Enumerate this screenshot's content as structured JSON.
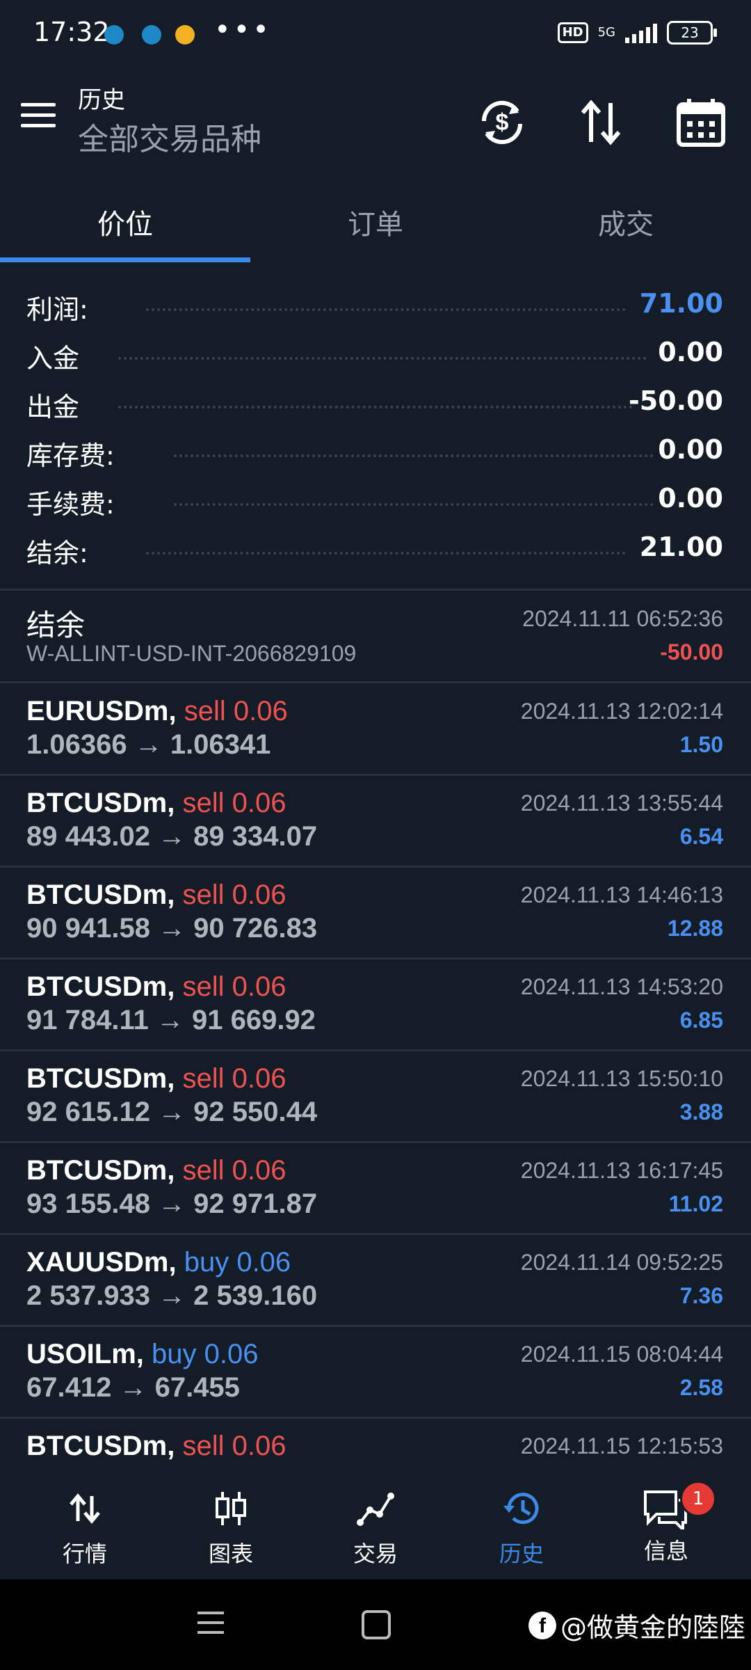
{
  "status_bar": {
    "time": "17:32",
    "network": "5G",
    "hd": "HD",
    "battery": "23",
    "more": "•••"
  },
  "app_bar": {
    "title": "历史",
    "subtitle": "全部交易品种"
  },
  "tabs": [
    {
      "label": "价位",
      "active": true
    },
    {
      "label": "订单",
      "active": false
    },
    {
      "label": "成交",
      "active": false
    }
  ],
  "summary": [
    {
      "label": "利润:",
      "value": "71.00"
    },
    {
      "label": "入金",
      "value": "0.00"
    },
    {
      "label": "出金",
      "value": "-50.00"
    },
    {
      "label": "库存费:",
      "value": "0.00"
    },
    {
      "label": "手续费:",
      "value": "0.00"
    },
    {
      "label": "结余:",
      "value": "21.00"
    }
  ],
  "balance_entry": {
    "title": "结余",
    "id": "W-ALLINT-USD-INT-2066829109",
    "time": "2024.11.11 06:52:36",
    "amount": "-50.00"
  },
  "deals": [
    {
      "symbol": "EURUSDm,",
      "side": "sell 0.06",
      "prices": "1.06366 → 1.06341",
      "time": "2024.11.13 12:02:14",
      "profit": "1.50"
    },
    {
      "symbol": "BTCUSDm,",
      "side": "sell 0.06",
      "prices": "89 443.02 → 89 334.07",
      "time": "2024.11.13 13:55:44",
      "profit": "6.54"
    },
    {
      "symbol": "BTCUSDm,",
      "side": "sell 0.06",
      "prices": "90 941.58 → 90 726.83",
      "time": "2024.11.13 14:46:13",
      "profit": "12.88"
    },
    {
      "symbol": "BTCUSDm,",
      "side": "sell 0.06",
      "prices": "91 784.11 → 91 669.92",
      "time": "2024.11.13 14:53:20",
      "profit": "6.85"
    },
    {
      "symbol": "BTCUSDm,",
      "side": "sell 0.06",
      "prices": "92 615.12 → 92 550.44",
      "time": "2024.11.13 15:50:10",
      "profit": "3.88"
    },
    {
      "symbol": "BTCUSDm,",
      "side": "sell 0.06",
      "prices": "93 155.48 → 92 971.87",
      "time": "2024.11.13 16:17:45",
      "profit": "11.02"
    },
    {
      "symbol": "XAUUSDm,",
      "side": "buy 0.06",
      "prices": "2 537.933 → 2 539.160",
      "time": "2024.11.14 09:52:25",
      "profit": "7.36"
    },
    {
      "symbol": "USOILm,",
      "side": "buy 0.06",
      "prices": "67.412 → 67.455",
      "time": "2024.11.15 08:04:44",
      "profit": "2.58"
    },
    {
      "symbol": "BTCUSDm,",
      "side": "sell 0.06",
      "prices": "",
      "time": "2024.11.15 12:15:53",
      "profit": ""
    }
  ],
  "bottom_nav": [
    {
      "label": "行情",
      "icon": "quotes-icon"
    },
    {
      "label": "图表",
      "icon": "chart-icon"
    },
    {
      "label": "交易",
      "icon": "trade-icon"
    },
    {
      "label": "历史",
      "icon": "history-icon",
      "active": true
    },
    {
      "label": "信息",
      "icon": "messages-icon",
      "badge": "1"
    }
  ],
  "watermark": "@做黄金的陸陸",
  "colors": {
    "background": "#141c27",
    "accent_blue": "#4a90f0",
    "sell_red": "#f05252"
  }
}
